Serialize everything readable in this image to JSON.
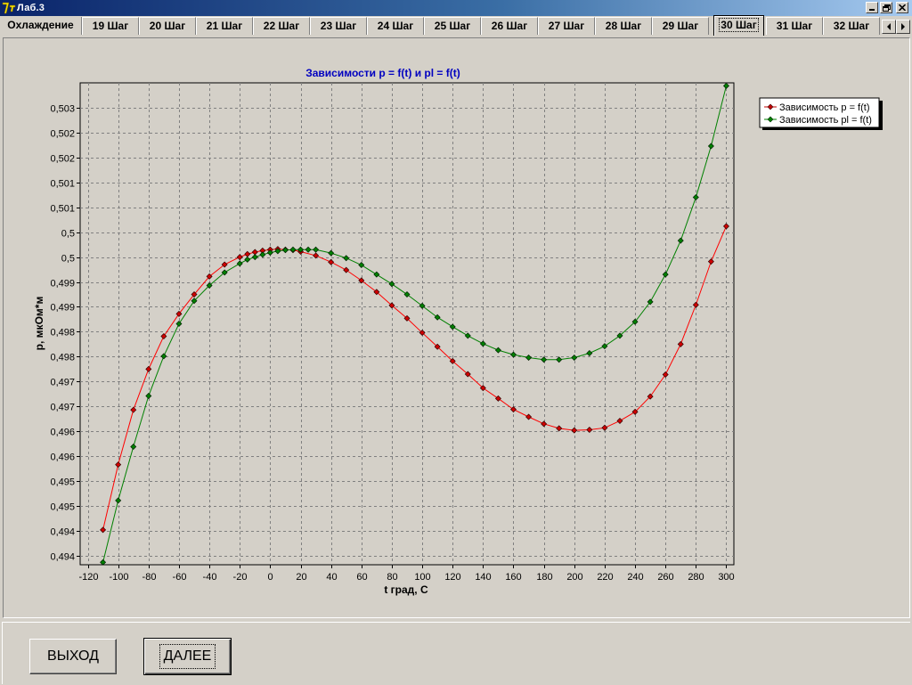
{
  "window": {
    "title": "Лаб.3",
    "icon": "app-logo-icon",
    "controls": [
      "minimize-icon",
      "restore-icon",
      "close-icon"
    ]
  },
  "tabs": {
    "items": [
      "Охлаждение",
      "19 Шаг",
      "20 Шаг",
      "21 Шаг",
      "22 Шаг",
      "23 Шаг",
      "24 Шаг",
      "25 Шаг",
      "26 Шаг",
      "27 Шаг",
      "28 Шаг",
      "29 Шаг",
      "30 Шаг",
      "31 Шаг",
      "32 Шаг"
    ],
    "active_index": 12,
    "scroll": [
      "arrow-left-icon",
      "arrow-right-icon"
    ]
  },
  "buttons": {
    "exit": "ВЫХОД",
    "next": "ДАЛЕЕ"
  },
  "colors": {
    "title_text": "#0000c0",
    "series_p": "#ff0000",
    "series_pl": "#008000"
  },
  "chart_data": {
    "type": "line",
    "title": "Зависимости p = f(t) и pl = f(t)",
    "xlabel": "t град, C",
    "ylabel": "p, мкОм*м",
    "xlim": [
      -125,
      305
    ],
    "ylim": [
      0.49372,
      0.5034
    ],
    "x_ticks": [
      -120,
      -100,
      -80,
      -60,
      -40,
      -20,
      0,
      20,
      40,
      60,
      80,
      100,
      120,
      140,
      160,
      180,
      200,
      220,
      240,
      260,
      280,
      300
    ],
    "y_ticks": [
      {
        "value": 0.4939,
        "label": "0,494"
      },
      {
        "value": 0.4944,
        "label": "0,494"
      },
      {
        "value": 0.4949,
        "label": "0,495"
      },
      {
        "value": 0.4954,
        "label": "0,495"
      },
      {
        "value": 0.4959,
        "label": "0,496"
      },
      {
        "value": 0.4964,
        "label": "0,496"
      },
      {
        "value": 0.4969,
        "label": "0,497"
      },
      {
        "value": 0.4974,
        "label": "0,497"
      },
      {
        "value": 0.4979,
        "label": "0,498"
      },
      {
        "value": 0.4984,
        "label": "0,498"
      },
      {
        "value": 0.4989,
        "label": "0,499"
      },
      {
        "value": 0.4994,
        "label": "0,499"
      },
      {
        "value": 0.4999,
        "label": "0,5"
      },
      {
        "value": 0.5004,
        "label": "0,5"
      },
      {
        "value": 0.5009,
        "label": "0,501"
      },
      {
        "value": 0.5014,
        "label": "0,501"
      },
      {
        "value": 0.5019,
        "label": "0,502"
      },
      {
        "value": 0.5024,
        "label": "0,502"
      },
      {
        "value": 0.5029,
        "label": "0,503"
      }
    ],
    "grid": true,
    "legend_position": "top-right",
    "series": [
      {
        "name": "Зависимость p = f(t)",
        "color": "#ff0000",
        "x": [
          -110,
          -100,
          -90,
          -80,
          -70,
          -60,
          -50,
          -40,
          -30,
          -20,
          -15,
          -10,
          -5,
          0,
          5,
          10,
          15,
          20,
          30,
          40,
          50,
          60,
          70,
          80,
          90,
          100,
          110,
          120,
          130,
          140,
          150,
          160,
          170,
          180,
          190,
          200,
          210,
          220,
          230,
          240,
          250,
          260,
          270,
          280,
          290,
          300
        ],
        "y": [
          0.49442,
          0.49573,
          0.49683,
          0.49765,
          0.49831,
          0.49876,
          0.49915,
          0.49951,
          0.49975,
          0.4999,
          0.49996,
          0.5,
          0.50003,
          0.50005,
          0.50006,
          0.50005,
          0.50004,
          0.50001,
          0.49993,
          0.4998,
          0.49964,
          0.49943,
          0.4992,
          0.49893,
          0.49867,
          0.49838,
          0.4981,
          0.49781,
          0.49755,
          0.49727,
          0.49706,
          0.49684,
          0.49669,
          0.49655,
          0.49646,
          0.49642,
          0.49643,
          0.49647,
          0.49661,
          0.49679,
          0.4971,
          0.49754,
          0.49815,
          0.49894,
          0.49981,
          0.50052
        ]
      },
      {
        "name": "Зависимость pl = f(t)",
        "color": "#008000",
        "x": [
          -110,
          -100,
          -90,
          -80,
          -70,
          -60,
          -50,
          -40,
          -30,
          -20,
          -15,
          -10,
          -5,
          0,
          5,
          10,
          15,
          20,
          25,
          30,
          40,
          50,
          60,
          70,
          80,
          90,
          100,
          110,
          120,
          130,
          140,
          150,
          160,
          170,
          180,
          190,
          200,
          210,
          220,
          230,
          240,
          250,
          260,
          270,
          280,
          290,
          300
        ],
        "y": [
          0.49377,
          0.49501,
          0.49609,
          0.49711,
          0.49791,
          0.49856,
          0.49902,
          0.49933,
          0.49959,
          0.49977,
          0.49985,
          0.4999,
          0.49995,
          0.49999,
          0.50002,
          0.50004,
          0.50005,
          0.50005,
          0.50005,
          0.50005,
          0.49998,
          0.49988,
          0.49974,
          0.49955,
          0.49936,
          0.49915,
          0.49892,
          0.49869,
          0.4985,
          0.49832,
          0.49816,
          0.49803,
          0.49794,
          0.49788,
          0.49784,
          0.49784,
          0.49788,
          0.49797,
          0.49811,
          0.49832,
          0.4986,
          0.499,
          0.49955,
          0.50023,
          0.5011,
          0.50213,
          0.50334
        ]
      }
    ]
  }
}
